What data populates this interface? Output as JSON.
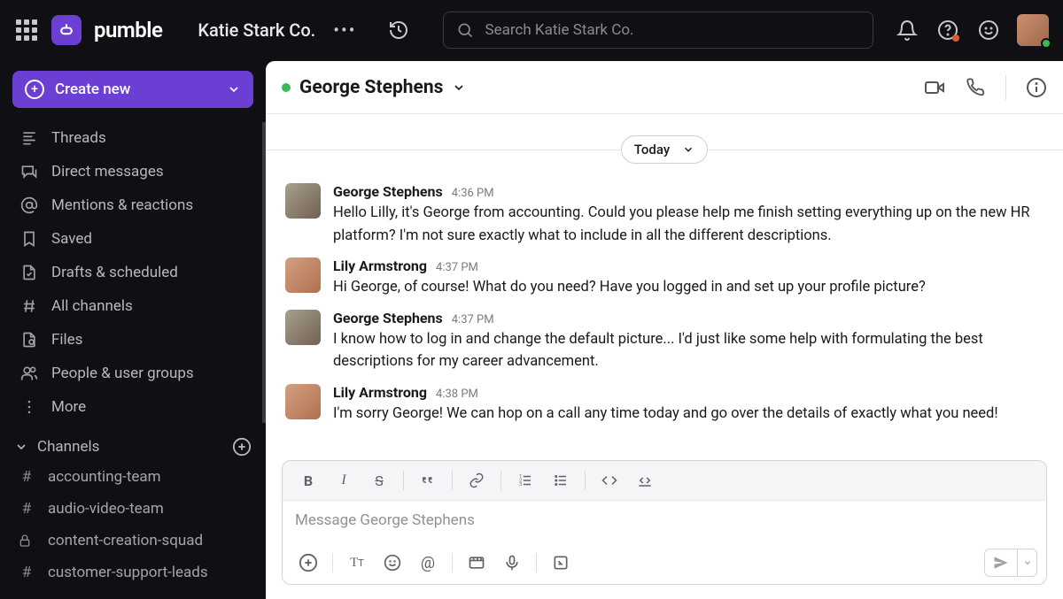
{
  "brand": "pumble",
  "workspace": "Katie Stark Co.",
  "search_placeholder": "Search Katie Stark Co.",
  "create_button": "Create new",
  "nav_items": [
    "Threads",
    "Direct messages",
    "Mentions & reactions",
    "Saved",
    "Drafts & scheduled",
    "All channels",
    "Files",
    "People & user groups",
    "More"
  ],
  "channels_header": "Channels",
  "channels": [
    {
      "name": "accounting-team",
      "locked": false
    },
    {
      "name": "audio-video-team",
      "locked": false
    },
    {
      "name": "content-creation-squad",
      "locked": true
    },
    {
      "name": "customer-support-leads",
      "locked": false
    }
  ],
  "dm": {
    "name": "George Stephens",
    "date_label": "Today",
    "messages": [
      {
        "author": "George Stephens",
        "time": "4:36 PM",
        "avatar": "g",
        "text": "Hello Lilly, it's George from accounting. Could you please help me finish setting everything up on the new HR platform? I'm not sure exactly what to include in all the different descriptions."
      },
      {
        "author": "Lily Armstrong",
        "time": "4:37 PM",
        "avatar": "l",
        "text": "Hi George, of course! What do you need? Have you logged in and set up your profile picture?"
      },
      {
        "author": "George Stephens",
        "time": "4:37 PM",
        "avatar": "g",
        "text": "I know how to log in and change the default picture... I'd just like some help with formulating the best descriptions for my career advancement."
      },
      {
        "author": "Lily Armstrong",
        "time": "4:38 PM",
        "avatar": "l",
        "text": "I'm sorry George! We can hop on a call any time today and go over the details of exactly what you need!"
      }
    ],
    "compose_placeholder": "Message George Stephens"
  }
}
